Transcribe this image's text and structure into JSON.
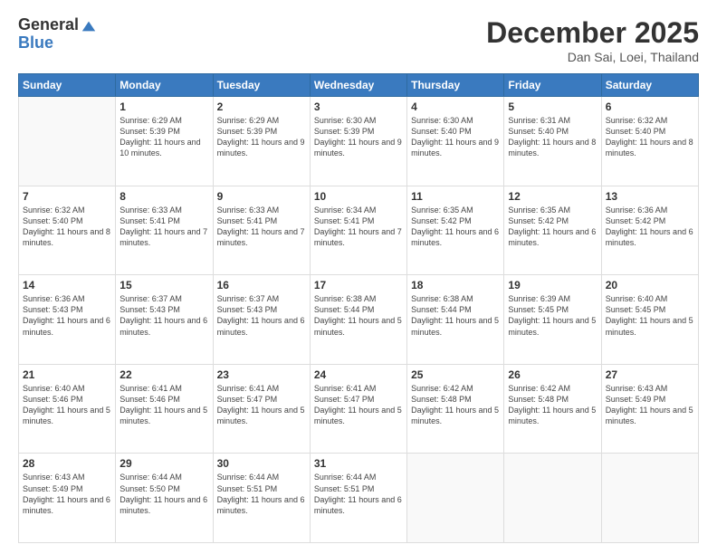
{
  "header": {
    "logo_general": "General",
    "logo_blue": "Blue",
    "month_title": "December 2025",
    "subtitle": "Dan Sai, Loei, Thailand"
  },
  "weekdays": [
    "Sunday",
    "Monday",
    "Tuesday",
    "Wednesday",
    "Thursday",
    "Friday",
    "Saturday"
  ],
  "weeks": [
    [
      {
        "day": "",
        "sunrise": "",
        "sunset": "",
        "daylight": ""
      },
      {
        "day": "1",
        "sunrise": "Sunrise: 6:29 AM",
        "sunset": "Sunset: 5:39 PM",
        "daylight": "Daylight: 11 hours and 10 minutes."
      },
      {
        "day": "2",
        "sunrise": "Sunrise: 6:29 AM",
        "sunset": "Sunset: 5:39 PM",
        "daylight": "Daylight: 11 hours and 9 minutes."
      },
      {
        "day": "3",
        "sunrise": "Sunrise: 6:30 AM",
        "sunset": "Sunset: 5:39 PM",
        "daylight": "Daylight: 11 hours and 9 minutes."
      },
      {
        "day": "4",
        "sunrise": "Sunrise: 6:30 AM",
        "sunset": "Sunset: 5:40 PM",
        "daylight": "Daylight: 11 hours and 9 minutes."
      },
      {
        "day": "5",
        "sunrise": "Sunrise: 6:31 AM",
        "sunset": "Sunset: 5:40 PM",
        "daylight": "Daylight: 11 hours and 8 minutes."
      },
      {
        "day": "6",
        "sunrise": "Sunrise: 6:32 AM",
        "sunset": "Sunset: 5:40 PM",
        "daylight": "Daylight: 11 hours and 8 minutes."
      }
    ],
    [
      {
        "day": "7",
        "sunrise": "Sunrise: 6:32 AM",
        "sunset": "Sunset: 5:40 PM",
        "daylight": "Daylight: 11 hours and 8 minutes."
      },
      {
        "day": "8",
        "sunrise": "Sunrise: 6:33 AM",
        "sunset": "Sunset: 5:41 PM",
        "daylight": "Daylight: 11 hours and 7 minutes."
      },
      {
        "day": "9",
        "sunrise": "Sunrise: 6:33 AM",
        "sunset": "Sunset: 5:41 PM",
        "daylight": "Daylight: 11 hours and 7 minutes."
      },
      {
        "day": "10",
        "sunrise": "Sunrise: 6:34 AM",
        "sunset": "Sunset: 5:41 PM",
        "daylight": "Daylight: 11 hours and 7 minutes."
      },
      {
        "day": "11",
        "sunrise": "Sunrise: 6:35 AM",
        "sunset": "Sunset: 5:42 PM",
        "daylight": "Daylight: 11 hours and 6 minutes."
      },
      {
        "day": "12",
        "sunrise": "Sunrise: 6:35 AM",
        "sunset": "Sunset: 5:42 PM",
        "daylight": "Daylight: 11 hours and 6 minutes."
      },
      {
        "day": "13",
        "sunrise": "Sunrise: 6:36 AM",
        "sunset": "Sunset: 5:42 PM",
        "daylight": "Daylight: 11 hours and 6 minutes."
      }
    ],
    [
      {
        "day": "14",
        "sunrise": "Sunrise: 6:36 AM",
        "sunset": "Sunset: 5:43 PM",
        "daylight": "Daylight: 11 hours and 6 minutes."
      },
      {
        "day": "15",
        "sunrise": "Sunrise: 6:37 AM",
        "sunset": "Sunset: 5:43 PM",
        "daylight": "Daylight: 11 hours and 6 minutes."
      },
      {
        "day": "16",
        "sunrise": "Sunrise: 6:37 AM",
        "sunset": "Sunset: 5:43 PM",
        "daylight": "Daylight: 11 hours and 6 minutes."
      },
      {
        "day": "17",
        "sunrise": "Sunrise: 6:38 AM",
        "sunset": "Sunset: 5:44 PM",
        "daylight": "Daylight: 11 hours and 5 minutes."
      },
      {
        "day": "18",
        "sunrise": "Sunrise: 6:38 AM",
        "sunset": "Sunset: 5:44 PM",
        "daylight": "Daylight: 11 hours and 5 minutes."
      },
      {
        "day": "19",
        "sunrise": "Sunrise: 6:39 AM",
        "sunset": "Sunset: 5:45 PM",
        "daylight": "Daylight: 11 hours and 5 minutes."
      },
      {
        "day": "20",
        "sunrise": "Sunrise: 6:40 AM",
        "sunset": "Sunset: 5:45 PM",
        "daylight": "Daylight: 11 hours and 5 minutes."
      }
    ],
    [
      {
        "day": "21",
        "sunrise": "Sunrise: 6:40 AM",
        "sunset": "Sunset: 5:46 PM",
        "daylight": "Daylight: 11 hours and 5 minutes."
      },
      {
        "day": "22",
        "sunrise": "Sunrise: 6:41 AM",
        "sunset": "Sunset: 5:46 PM",
        "daylight": "Daylight: 11 hours and 5 minutes."
      },
      {
        "day": "23",
        "sunrise": "Sunrise: 6:41 AM",
        "sunset": "Sunset: 5:47 PM",
        "daylight": "Daylight: 11 hours and 5 minutes."
      },
      {
        "day": "24",
        "sunrise": "Sunrise: 6:41 AM",
        "sunset": "Sunset: 5:47 PM",
        "daylight": "Daylight: 11 hours and 5 minutes."
      },
      {
        "day": "25",
        "sunrise": "Sunrise: 6:42 AM",
        "sunset": "Sunset: 5:48 PM",
        "daylight": "Daylight: 11 hours and 5 minutes."
      },
      {
        "day": "26",
        "sunrise": "Sunrise: 6:42 AM",
        "sunset": "Sunset: 5:48 PM",
        "daylight": "Daylight: 11 hours and 5 minutes."
      },
      {
        "day": "27",
        "sunrise": "Sunrise: 6:43 AM",
        "sunset": "Sunset: 5:49 PM",
        "daylight": "Daylight: 11 hours and 5 minutes."
      }
    ],
    [
      {
        "day": "28",
        "sunrise": "Sunrise: 6:43 AM",
        "sunset": "Sunset: 5:49 PM",
        "daylight": "Daylight: 11 hours and 6 minutes."
      },
      {
        "day": "29",
        "sunrise": "Sunrise: 6:44 AM",
        "sunset": "Sunset: 5:50 PM",
        "daylight": "Daylight: 11 hours and 6 minutes."
      },
      {
        "day": "30",
        "sunrise": "Sunrise: 6:44 AM",
        "sunset": "Sunset: 5:51 PM",
        "daylight": "Daylight: 11 hours and 6 minutes."
      },
      {
        "day": "31",
        "sunrise": "Sunrise: 6:44 AM",
        "sunset": "Sunset: 5:51 PM",
        "daylight": "Daylight: 11 hours and 6 minutes."
      },
      {
        "day": "",
        "sunrise": "",
        "sunset": "",
        "daylight": ""
      },
      {
        "day": "",
        "sunrise": "",
        "sunset": "",
        "daylight": ""
      },
      {
        "day": "",
        "sunrise": "",
        "sunset": "",
        "daylight": ""
      }
    ]
  ]
}
